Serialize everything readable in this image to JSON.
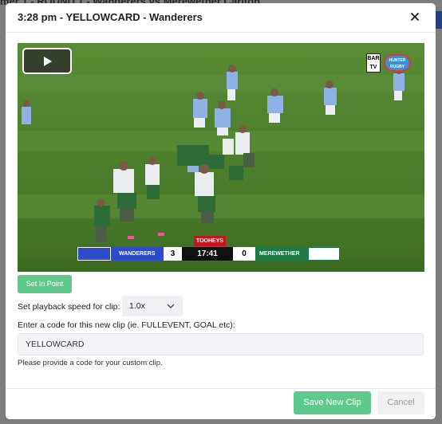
{
  "background": {
    "page_title": "mer 1 - ROUND 1 - Wanderers vs Merewether Carlton"
  },
  "modal": {
    "title": "3:28 pm - YELLOWCARD - Wanderers",
    "close_icon": "close-icon"
  },
  "video": {
    "play_icon": "play-icon",
    "scoreboard": {
      "home_team": "WANDERERS",
      "home_score": "3",
      "clock": "17:41",
      "away_score": "0",
      "away_team": "MEREWETHER",
      "sponsor": "TOOHEYS"
    },
    "broadcaster_badge": "BAR TV",
    "partner_badge": "HUNTER RUGBY"
  },
  "controls": {
    "set_in_point_label": "Set In Point",
    "speed_label": "Set playback speed for clip:",
    "speed_value": "1.0x",
    "code_label": "Enter a code for this new clip (ie. FULLEVENT, GOAL etc):",
    "code_value": "YELLOWCARD",
    "helper_text": "Please provide a code for your custom clip."
  },
  "footer": {
    "save_label": "Save New Clip",
    "cancel_label": "Cancel"
  },
  "colors": {
    "accent": "#5fc98b",
    "home_team": "#2d4cc9",
    "away_team": "#1e7a45"
  }
}
